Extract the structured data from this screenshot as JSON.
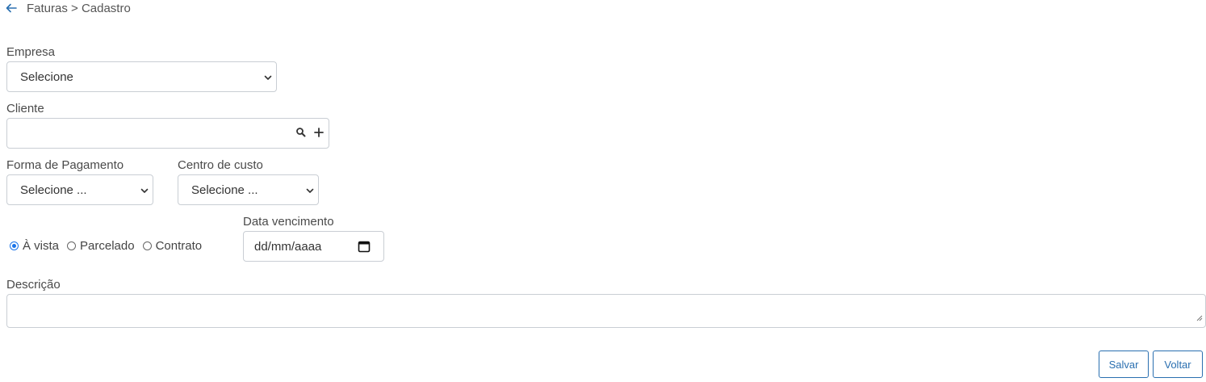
{
  "breadcrumb": {
    "text": "Faturas > Cadastro"
  },
  "colors": {
    "accent": "#2a6fb0",
    "radio_checked": "#1a73e8",
    "border": "#c9ced4"
  },
  "icons": {
    "back": "arrow-left-icon",
    "select": "chevron-down-icon",
    "search": "search-icon",
    "add": "plus-icon",
    "calendar": "calendar-icon"
  },
  "form": {
    "empresa": {
      "label": "Empresa",
      "selected": "Selecione"
    },
    "cliente": {
      "label": "Cliente",
      "value": ""
    },
    "forma_pagamento": {
      "label": "Forma de Pagamento",
      "selected": "Selecione ..."
    },
    "centro_custo": {
      "label": "Centro de custo",
      "selected": "Selecione ..."
    },
    "tipo_pagamento": {
      "options": [
        "À vista",
        "Parcelado",
        "Contrato"
      ],
      "selected": "À vista"
    },
    "data_vencimento": {
      "label": "Data vencimento",
      "placeholder": "dd/mm/aaaa"
    },
    "descricao": {
      "label": "Descrição",
      "value": ""
    }
  },
  "actions": {
    "save_label": "Salvar",
    "back_label": "Voltar"
  }
}
